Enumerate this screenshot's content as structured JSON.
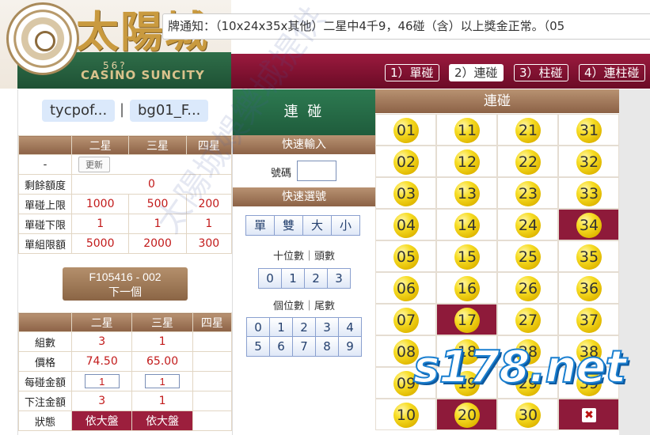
{
  "marquee": {
    "text": "牌通知：（10x24x35x其他）二星中4千9，46碰（含）以上獎金正常。（05"
  },
  "logo": {
    "title_cn": "太陽城",
    "number": "56?",
    "title_en": "CASINO SUNCITY"
  },
  "tabs": [
    {
      "label": "1）單碰",
      "active": false
    },
    {
      "label": "2）連碰",
      "active": true
    },
    {
      "label": "3）柱碰",
      "active": false
    },
    {
      "label": "4）連柱碰",
      "active": false
    }
  ],
  "accounts": {
    "user1": "tycpof...",
    "separator": "|",
    "user2": "bg01_F..."
  },
  "limits": {
    "headers": [
      "",
      "二星",
      "三星",
      "四星"
    ],
    "refresh_label": "更新",
    "refresh_row_label": "-",
    "rows": [
      {
        "label": "剩餘額度",
        "value": "0"
      },
      {
        "label": "單碰上限",
        "values": [
          "1000",
          "500",
          "200"
        ]
      },
      {
        "label": "單碰下限",
        "values": [
          "1",
          "1",
          "1"
        ]
      },
      {
        "label": "單組限額",
        "values": [
          "5000",
          "2000",
          "300"
        ]
      }
    ]
  },
  "next_button": {
    "line1": "F105416 - 002",
    "line2": "下一個"
  },
  "bet_table": {
    "headers": [
      "",
      "二星",
      "三星",
      "四星"
    ],
    "groups_label": "組數",
    "groups": [
      "3",
      "1",
      ""
    ],
    "price_label": "價格",
    "price": [
      "74.50",
      "65.00",
      ""
    ],
    "amount_label": "每碰金額",
    "amount": [
      "1",
      "1"
    ],
    "total_label": "下注金額",
    "total": [
      "3",
      "1",
      ""
    ],
    "status_label": "狀態",
    "status": [
      "依大盤",
      "依大盤"
    ]
  },
  "mid": {
    "title": "連 碰",
    "quick_input": "快速輸入",
    "number_label": "號碼",
    "quick_select": "快速選號",
    "parity_buttons": [
      "單",
      "雙",
      "大",
      "小"
    ],
    "tens_caption": "十位數｜頭數",
    "tens_buttons": [
      "0",
      "1",
      "2",
      "3"
    ],
    "units_caption": "個位數｜尾數",
    "units_buttons": [
      "0",
      "1",
      "2",
      "3",
      "4",
      "5",
      "6",
      "7",
      "8",
      "9"
    ]
  },
  "board": {
    "title": "連碰",
    "numbers": [
      "01",
      "11",
      "21",
      "31",
      "02",
      "12",
      "22",
      "32",
      "03",
      "13",
      "23",
      "33",
      "04",
      "14",
      "24",
      "34",
      "05",
      "15",
      "25",
      "35",
      "06",
      "16",
      "26",
      "36",
      "07",
      "17",
      "27",
      "37",
      "08",
      "18",
      "28",
      "38",
      "09",
      "19",
      "29",
      "39",
      "10",
      "20",
      "30",
      "X"
    ],
    "selected": [
      "34",
      "17",
      "20",
      "X"
    ],
    "selected_color": "#8e1a3a",
    "ball_color": "#f7dd25",
    "clear_icon": "close-icon"
  },
  "watermarks": {
    "diagonal": "太陽城娛樂城提供",
    "site": "s178.net"
  }
}
